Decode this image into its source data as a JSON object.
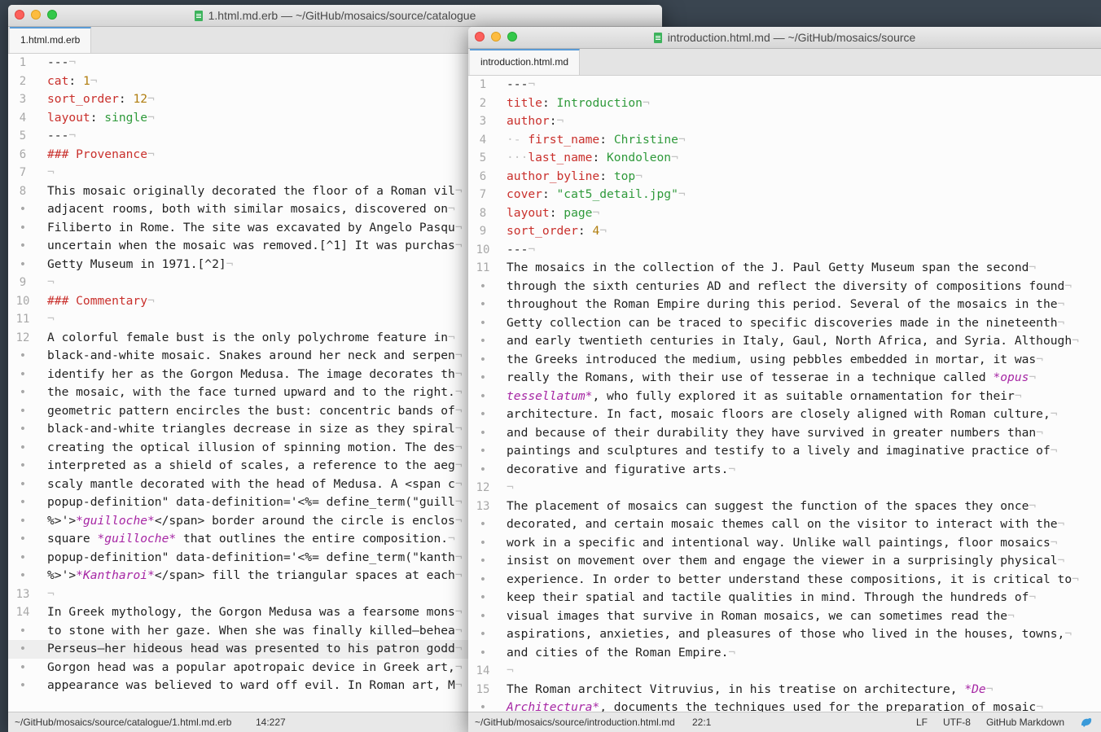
{
  "colors": {
    "key": "#c9302c",
    "string": "#2f9a3b",
    "number": "#b07d0e",
    "emphasis": "#a626a4",
    "gutter": "#a8a8a8"
  },
  "window1": {
    "title": "1.html.md.erb — ~/GitHub/mosaics/source/catalogue",
    "tab": "1.html.md.erb",
    "status": {
      "path": "~/GitHub/mosaics/source/catalogue/1.html.md.erb",
      "position": "14:227"
    },
    "lines": [
      {
        "g": "1",
        "t": "---"
      },
      {
        "g": "2",
        "k": "cat",
        "n": "1"
      },
      {
        "g": "3",
        "k": "sort_order",
        "n": "12"
      },
      {
        "g": "4",
        "k": "layout",
        "v": "single"
      },
      {
        "g": "5",
        "t": "---"
      },
      {
        "g": "6",
        "h": "### Provenance"
      },
      {
        "g": "7",
        "t": ""
      },
      {
        "g": "8",
        "t": "This mosaic originally decorated the floor of a Roman vil"
      },
      {
        "g": "•",
        "t": "adjacent rooms, both with similar mosaics, discovered on"
      },
      {
        "g": "•",
        "t": "Filiberto in Rome. The site was excavated by Angelo Pasqu"
      },
      {
        "g": "•",
        "t": "uncertain when the mosaic was removed.[^1] It was purchas"
      },
      {
        "g": "•",
        "t": "Getty Museum in 1971.[^2]"
      },
      {
        "g": "9",
        "t": ""
      },
      {
        "g": "10",
        "h": "### Commentary"
      },
      {
        "g": "11",
        "t": ""
      },
      {
        "g": "12",
        "t": "A colorful female bust is the only polychrome feature in"
      },
      {
        "g": "•",
        "t": "black-and-white mosaic. Snakes around her neck and serpen"
      },
      {
        "g": "•",
        "t": "identify her as the Gorgon Medusa. The image decorates th"
      },
      {
        "g": "•",
        "t": "the mosaic, with the face turned upward and to the right."
      },
      {
        "g": "•",
        "t": "geometric pattern encircles the bust: concentric bands of"
      },
      {
        "g": "•",
        "t": "black-and-white triangles decrease in size as they spiral"
      },
      {
        "g": "•",
        "t": "creating the optical illusion of spinning motion. The des"
      },
      {
        "g": "•",
        "t": "interpreted as a shield of scales, a reference to the aeg"
      },
      {
        "g": "•",
        "t": "scaly mantle decorated with the head of Medusa. A <span c"
      },
      {
        "g": "•",
        "t": "popup-definition\" data-definition='<%= define_term(\"guill"
      },
      {
        "g": "•",
        "t": "%>'>",
        "e": "*guilloche*",
        "t2": "</span> border around the circle is enclos"
      },
      {
        "g": "•",
        "t": "square ",
        "e": "*guilloche*",
        "t2": " that outlines the entire composition."
      },
      {
        "g": "•",
        "t": "popup-definition\" data-definition='<%= define_term(\"kanth"
      },
      {
        "g": "•",
        "t": "%>'>",
        "e": "*Kantharoi*",
        "t2": "</span> fill the triangular spaces at each"
      },
      {
        "g": "13",
        "t": ""
      },
      {
        "g": "14",
        "t": "In Greek mythology, the Gorgon Medusa was a fearsome mons"
      },
      {
        "g": "•",
        "t": "to stone with her gaze. When she was finally killed—behea"
      },
      {
        "g": "•",
        "t": "Perseus—her hideous head was presented to his patron godd",
        "cur": true
      },
      {
        "g": "•",
        "t": "Gorgon head was a popular apotropaic device in Greek art,"
      },
      {
        "g": "•",
        "t": "appearance was believed to ward off evil. In Roman art, M"
      }
    ]
  },
  "window2": {
    "title": "introduction.html.md — ~/GitHub/mosaics/source",
    "tab": "introduction.html.md",
    "status": {
      "path": "~/GitHub/mosaics/source/introduction.html.md",
      "position": "22:1",
      "line_ending": "LF",
      "encoding": "UTF-8",
      "grammar": "GitHub Markdown"
    },
    "lines": [
      {
        "g": "1",
        "t": "---"
      },
      {
        "g": "2",
        "k": "title",
        "v": "Introduction"
      },
      {
        "g": "3",
        "k": "author",
        "v": ""
      },
      {
        "g": "4",
        "p": "·- ",
        "k": "first_name",
        "v": "Christine"
      },
      {
        "g": "5",
        "p": "···",
        "k": "last_name",
        "v": "Kondoleon"
      },
      {
        "g": "6",
        "k": "author_byline",
        "v": "top"
      },
      {
        "g": "7",
        "k": "cover",
        "v": "\"cat5_detail.jpg\""
      },
      {
        "g": "8",
        "k": "layout",
        "v": "page"
      },
      {
        "g": "9",
        "k": "sort_order",
        "n": "4"
      },
      {
        "g": "10",
        "t": "---"
      },
      {
        "g": "11",
        "t": "The mosaics in the collection of the J. Paul Getty Museum span the second"
      },
      {
        "g": "•",
        "t": "through the sixth centuries AD and reflect the diversity of compositions found"
      },
      {
        "g": "•",
        "t": "throughout the Roman Empire during this period. Several of the mosaics in the"
      },
      {
        "g": "•",
        "t": "Getty collection can be traced to specific discoveries made in the nineteenth"
      },
      {
        "g": "•",
        "t": "and early twentieth centuries in Italy, Gaul, North Africa, and Syria. Although"
      },
      {
        "g": "•",
        "t": "the Greeks introduced the medium, using pebbles embedded in mortar, it was"
      },
      {
        "g": "•",
        "t": "really the Romans, with their use of tesserae in a technique called ",
        "e": "*opus"
      },
      {
        "g": "•",
        "e": "tessellatum*",
        "t2": ", who fully explored it as suitable ornamentation for their"
      },
      {
        "g": "•",
        "t": "architecture. In fact, mosaic floors are closely aligned with Roman culture,"
      },
      {
        "g": "•",
        "t": "and because of their durability they have survived in greater numbers than"
      },
      {
        "g": "•",
        "t": "paintings and sculptures and testify to a lively and imaginative practice of"
      },
      {
        "g": "•",
        "t": "decorative and figurative arts."
      },
      {
        "g": "12",
        "t": ""
      },
      {
        "g": "13",
        "t": "The placement of mosaics can suggest the function of the spaces they once"
      },
      {
        "g": "•",
        "t": "decorated, and certain mosaic themes call on the visitor to interact with the"
      },
      {
        "g": "•",
        "t": "work in a specific and intentional way. Unlike wall paintings, floor mosaics"
      },
      {
        "g": "•",
        "t": "insist on movement over them and engage the viewer in a surprisingly physical"
      },
      {
        "g": "•",
        "t": "experience. In order to better understand these compositions, it is critical to"
      },
      {
        "g": "•",
        "t": "keep their spatial and tactile qualities in mind. Through the hundreds of"
      },
      {
        "g": "•",
        "t": "visual images that survive in Roman mosaics, we can sometimes read the"
      },
      {
        "g": "•",
        "t": "aspirations, anxieties, and pleasures of those who lived in the houses, towns,"
      },
      {
        "g": "•",
        "t": "and cities of the Roman Empire."
      },
      {
        "g": "14",
        "t": ""
      },
      {
        "g": "15",
        "t": "The Roman architect Vitruvius, in his treatise on architecture, ",
        "e": "*De"
      },
      {
        "g": "•",
        "e": "Architectura*",
        "t2": ", documents the techniques used for the preparation of mosaic"
      }
    ]
  }
}
